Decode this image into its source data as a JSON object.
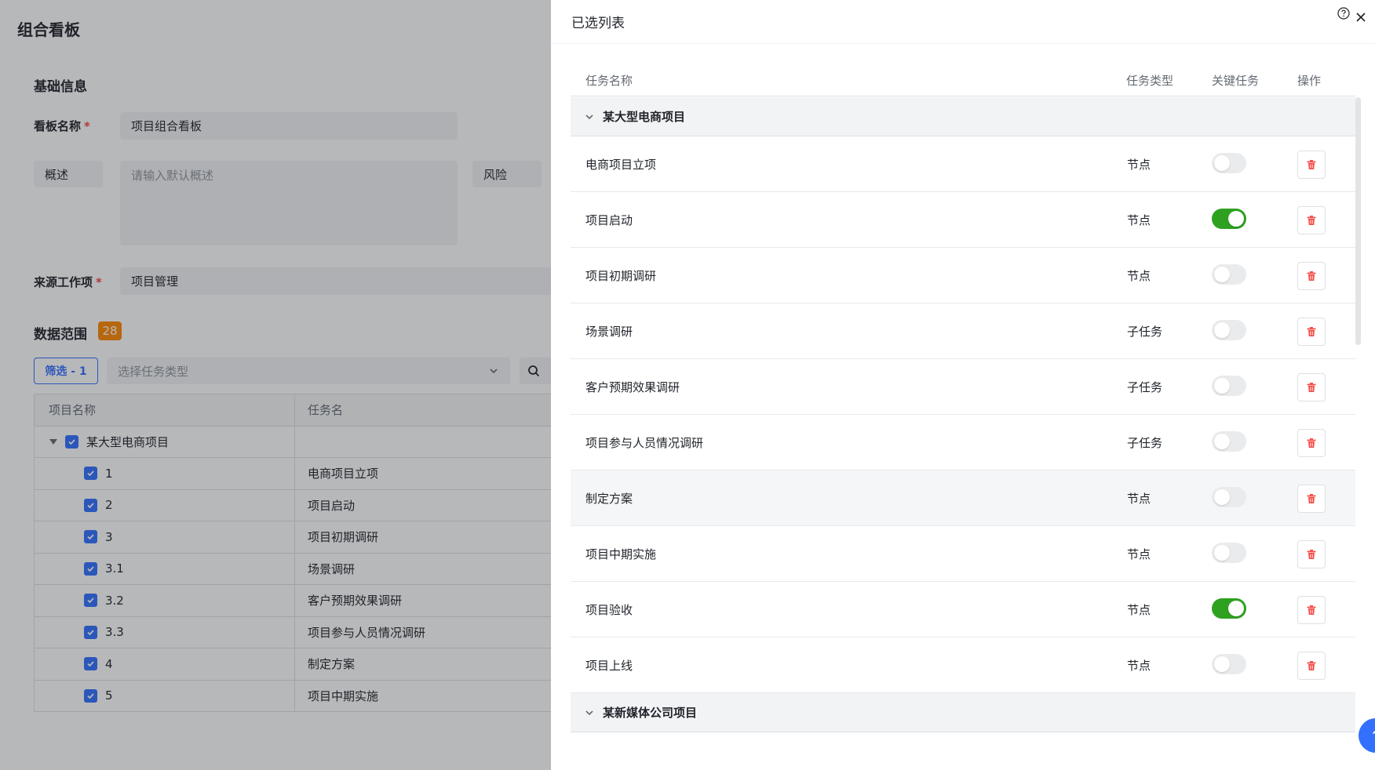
{
  "background": {
    "page_title": "组合看板",
    "basic_info_title": "基础信息",
    "board_name_label": "看板名称",
    "board_name_value": "项目组合看板",
    "summary_button": "概述",
    "summary_placeholder": "请输入默认概述",
    "risk_button": "风险",
    "source_label": "来源工作项",
    "source_value": "项目管理",
    "data_range_title": "数据范围",
    "data_range_count": "28",
    "filter_button": "筛选 - 1",
    "type_select_placeholder": "选择任务类型",
    "table": {
      "headers": [
        "项目名称",
        "任务名"
      ],
      "group": "某大型电商项目",
      "rows": [
        {
          "id": "1",
          "task": "电商项目立项"
        },
        {
          "id": "2",
          "task": "项目启动"
        },
        {
          "id": "3",
          "task": "项目初期调研"
        },
        {
          "id": "3.1",
          "task": "场景调研"
        },
        {
          "id": "3.2",
          "task": "客户预期效果调研"
        },
        {
          "id": "3.3",
          "task": "项目参与人员情况调研"
        },
        {
          "id": "4",
          "task": "制定方案"
        },
        {
          "id": "5",
          "task": "项目中期实施"
        }
      ]
    }
  },
  "drawer": {
    "title": "已选列表",
    "columns": {
      "name": "任务名称",
      "type": "任务类型",
      "key": "关键任务",
      "action": "操作"
    },
    "groups": [
      {
        "name": "某大型电商项目",
        "rows": [
          {
            "name": "电商项目立项",
            "type": "节点",
            "key": false
          },
          {
            "name": "项目启动",
            "type": "节点",
            "key": true
          },
          {
            "name": "项目初期调研",
            "type": "节点",
            "key": false
          },
          {
            "name": "场景调研",
            "type": "子任务",
            "key": false
          },
          {
            "name": "客户预期效果调研",
            "type": "子任务",
            "key": false
          },
          {
            "name": "项目参与人员情况调研",
            "type": "子任务",
            "key": false
          },
          {
            "name": "制定方案",
            "type": "节点",
            "key": false
          },
          {
            "name": "项目中期实施",
            "type": "节点",
            "key": false
          },
          {
            "name": "项目验收",
            "type": "节点",
            "key": true
          },
          {
            "name": "项目上线",
            "type": "节点",
            "key": false
          }
        ]
      },
      {
        "name": "某新媒体公司项目",
        "rows": []
      }
    ]
  },
  "colors": {
    "primary": "#3370ff",
    "toggle_on": "#2ea121",
    "danger": "#f54a45",
    "badge": "#ff8800"
  },
  "icons": [
    "help-icon",
    "close-icon",
    "chevron-down-icon",
    "trash-icon",
    "search-icon",
    "check-icon"
  ]
}
